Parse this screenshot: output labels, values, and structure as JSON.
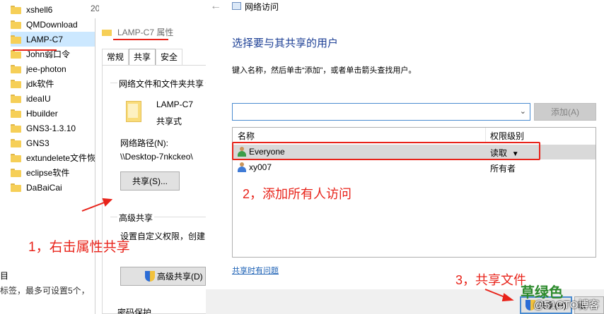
{
  "explorer": {
    "date_col": "20",
    "folders": [
      {
        "label": "xshell6"
      },
      {
        "label": "QMDownload"
      },
      {
        "label": "LAMP-C7"
      },
      {
        "label": "John弱口令"
      },
      {
        "label": "jee-photon"
      },
      {
        "label": "jdk软件"
      },
      {
        "label": "ideaIU"
      },
      {
        "label": "Hbuilder"
      },
      {
        "label": "GNS3-1.3.10"
      },
      {
        "label": "GNS3"
      },
      {
        "label": "extundelete文件恢"
      },
      {
        "label": "eclipse软件"
      },
      {
        "label": "DaBaiCai"
      }
    ],
    "status_mark": "目",
    "status_text": "标签，最多可设置5个，"
  },
  "properties": {
    "title": "LAMP-C7 属性",
    "tabs": [
      "常规",
      "共享",
      "安全"
    ],
    "group_title": "网络文件和文件夹共享",
    "folder_name": "LAMP-C7",
    "share_state": "共享式",
    "network_path_label": "网络路径(N):",
    "network_path": "\\\\Desktop-7nkckeo\\",
    "share_button": "共享(S)...",
    "advanced_title": "高级共享",
    "advanced_desc": "设置自定义权限，创建",
    "advanced_button": "高级共享(D)",
    "password_title": "密码保护"
  },
  "network_access": {
    "window_title": "网络访问",
    "heading": "选择要与其共享的用户",
    "description": "键入名称，然后单击“添加”，或者单击箭头查找用户。",
    "name_input_value": "",
    "add_button": "添加(A)",
    "columns": {
      "name": "名称",
      "permission": "权限级别"
    },
    "users": [
      {
        "name": "Everyone",
        "permission": "读取",
        "selected": true
      },
      {
        "name": "xy007",
        "permission": "所有者",
        "selected": false
      }
    ],
    "help_link": "共享时有问题",
    "share_button": "共享(H)",
    "cancel_button": "取"
  },
  "annotations": {
    "step1": "1，右击属性共享",
    "step2": "2，添加所有人访问",
    "step3": "3，共享文件"
  },
  "watermark": {
    "text": "草绿色",
    "site": "@51CTO博客"
  },
  "colors": {
    "annotation_red": "#e8231a",
    "heading_blue": "#1c3f95",
    "selection_blue": "#cce8ff",
    "watermark_green": "#2c8a2c"
  }
}
